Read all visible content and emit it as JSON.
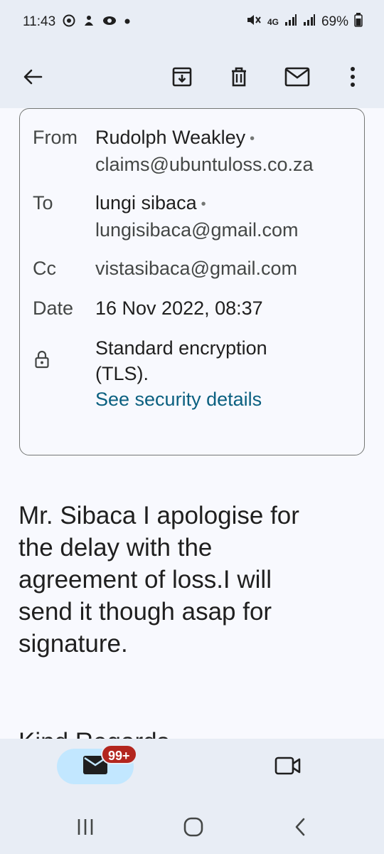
{
  "status_bar": {
    "time": "11:43",
    "network": "4G",
    "battery": "69%"
  },
  "toolbar": {
    "back_icon": "arrow-back-icon",
    "archive_icon": "archive-icon",
    "delete_icon": "trash-icon",
    "unread_icon": "mail-icon",
    "more_icon": "more-vert-icon"
  },
  "details": {
    "from_label": "From",
    "from_name": "Rudolph Weakley",
    "from_email": "claims@ubuntuloss.co.za",
    "to_label": "To",
    "to_name": "lungi sibaca",
    "to_email": "lungisibaca@gmail.com",
    "cc_label": "Cc",
    "cc_email": "vistasibaca@gmail.com",
    "date_label": "Date",
    "date_value": "16 Nov 2022, 08:37",
    "encryption_line1": "Standard encryption",
    "encryption_line2": "(TLS).",
    "security_link": "See security details"
  },
  "body": {
    "line1": "Mr. Sibaca I apologise for",
    "line2": "the delay with the",
    "line3": "agreement of loss.I will",
    "line4": "send it though asap for",
    "line5": "signature.",
    "closing": "Kind Regards"
  },
  "bottom_nav": {
    "mail_badge": "99+",
    "mail_icon": "mail-filled-icon",
    "meet_icon": "video-camera-icon"
  },
  "colors": {
    "accent_link": "#0b6080",
    "badge": "#b3261e",
    "chrome": "#e8edf5"
  }
}
